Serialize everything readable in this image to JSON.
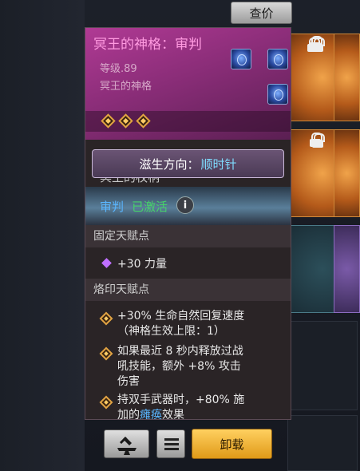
{
  "toolbar": {
    "price_check_label": "查价"
  },
  "item": {
    "title": "冥王的神格：审判",
    "level": "等级.89",
    "name": "冥王的神格",
    "growth_direction_label": "滋生方向：",
    "growth_direction_value": "顺时针",
    "cut_text": "冥王的权柄",
    "active_name": "审判",
    "active_state": "已激活",
    "info_glyph": "i"
  },
  "fixed_talents": {
    "header": "固定天赋点",
    "stats": [
      "+30 力量"
    ]
  },
  "imprint_talents": {
    "header": "烙印天赋点",
    "effects": [
      {
        "line1": "+30% 生命自然回复速度",
        "line2": "（神格生效上限：1）"
      },
      {
        "line1": "如果最近 8 秒内释放过战",
        "line2": "吼技能，额外 +8% 攻击",
        "line3": "伤害"
      },
      {
        "line1": "持双手武器时，+80% 施",
        "line2_prefix": "加的",
        "line2_blue": "瘫痪",
        "line2_suffix": "效果"
      }
    ]
  },
  "actions": {
    "anvil_icon": "anvil-icon",
    "menu_icon": "menu-icon",
    "unload_label": "卸载"
  },
  "colors": {
    "title": "#ff9ae0",
    "header_bg": "#8a2d78",
    "active_blue": "#5ab6ff",
    "active_green": "#47d26a",
    "unload_button": "#f0b030"
  }
}
